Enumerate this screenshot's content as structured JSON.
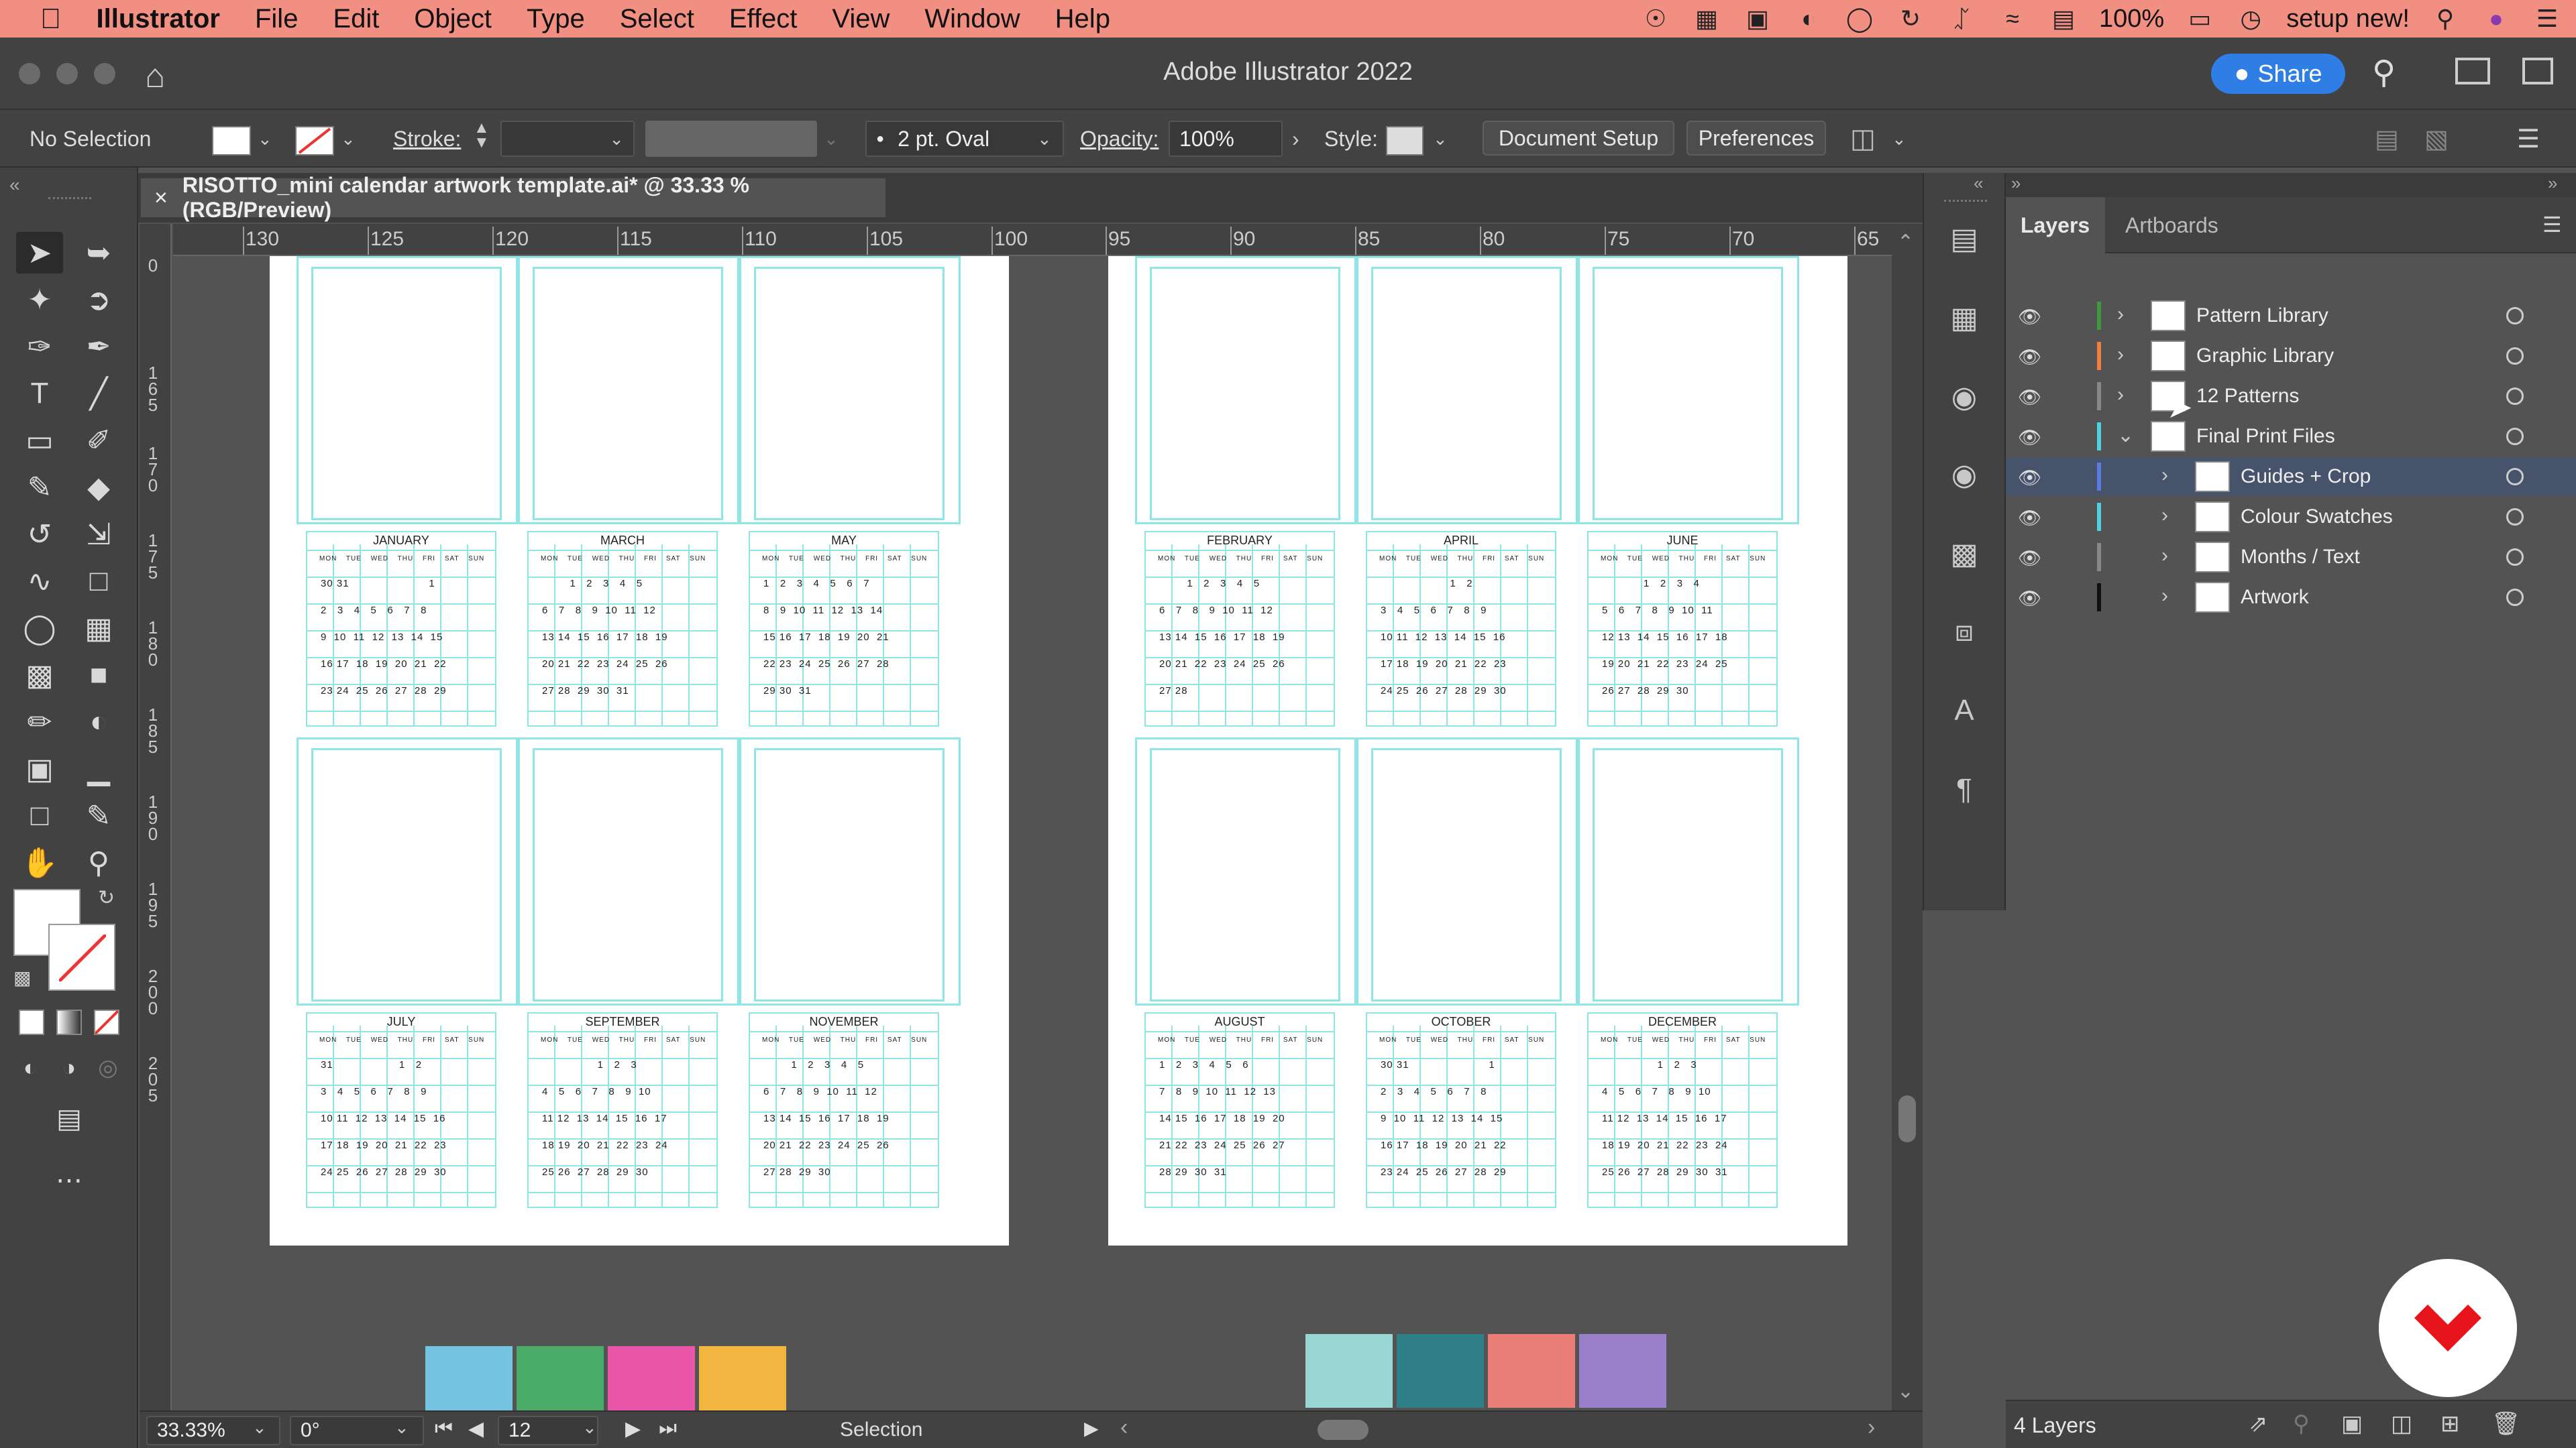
{
  "menubar": {
    "apple": "",
    "app": "Illustrator",
    "items": [
      "File",
      "Edit",
      "Object",
      "Type",
      "Select",
      "Effect",
      "View",
      "Window",
      "Help"
    ],
    "battery": "100%",
    "user": "setup new!"
  },
  "titlebar": {
    "title": "Adobe Illustrator 2022",
    "share_label": "Share"
  },
  "controlbar": {
    "selection": "No Selection",
    "stroke_label": "Stroke:",
    "brush": "2 pt. Oval",
    "opacity_label": "Opacity:",
    "opacity_value": "100%",
    "style_label": "Style:",
    "doc_setup": "Document Setup",
    "preferences": "Preferences"
  },
  "document": {
    "tab_title": "RISOTTO_mini calendar artwork template.ai* @ 33.33 % (RGB/Preview)"
  },
  "rulers": {
    "h": [
      "130",
      "125",
      "120",
      "115",
      "110",
      "105",
      "100",
      "95",
      "90",
      "85",
      "80",
      "75",
      "70",
      "65"
    ],
    "v": [
      "0",
      "165",
      "170",
      "175",
      "180",
      "185",
      "190",
      "195",
      "200",
      "205"
    ]
  },
  "calendar": {
    "left": {
      "top": [
        {
          "month": "JANUARY",
          "rows": [
            "30 31                       1",
            "2   3   4   5   6   7   8",
            "9  10  11  12  13  14  15",
            "16 17  18  19  20  21  22",
            "23 24  25  26  27  28  29"
          ]
        },
        {
          "month": "MARCH",
          "rows": [
            "        1   2   3   4   5",
            "6   7   8   9  10  11  12",
            "13 14  15  16  17  18  19",
            "20 21  22  23  24  25  26",
            "27 28  29  30  31"
          ]
        },
        {
          "month": "MAY",
          "rows": [
            "1   2   3   4   5   6   7",
            "8   9  10  11  12  13  14",
            "15 16  17  18  19  20  21",
            "22 23  24  25  26  27  28",
            "29 30  31"
          ]
        }
      ],
      "bottom": [
        {
          "month": "JULY",
          "rows": [
            "31                   1   2",
            "3   4   5   6   7   8   9",
            "10 11  12  13  14  15  16",
            "17 18  19  20  21  22  23",
            "24 25  26  27  28  29  30"
          ]
        },
        {
          "month": "SEPTEMBER",
          "rows": [
            "                1   2   3",
            "4   5   6   7   8   9  10",
            "11 12  13  14  15  16  17",
            "18 19  20  21  22  23  24",
            "25 26  27  28  29  30"
          ]
        },
        {
          "month": "NOVEMBER",
          "rows": [
            "        1   2   3   4   5",
            "6   7   8   9  10  11  12",
            "13 14  15  16  17  18  19",
            "20 21  22  23  24  25  26",
            "27 28  29  30"
          ]
        }
      ]
    },
    "right": {
      "top": [
        {
          "month": "FEBRUARY",
          "rows": [
            "        1   2   3   4   5",
            "6   7   8   9  10  11  12",
            "13 14  15  16  17  18  19",
            "20 21  22  23  24  25  26",
            "27 28"
          ]
        },
        {
          "month": "APRIL",
          "rows": [
            "                    1   2",
            "3   4   5   6   7   8   9",
            "10 11  12  13  14  15  16",
            "17 18  19  20  21  22  23",
            "24 25  26  27  28  29  30"
          ]
        },
        {
          "month": "JUNE",
          "rows": [
            "            1   2   3   4",
            "5   6   7   8   9  10  11",
            "12 13  14  15  16  17  18",
            "19 20  21  22  23  24  25",
            "26 27  28  29  30"
          ]
        }
      ],
      "bottom": [
        {
          "month": "AUGUST",
          "rows": [
            "1   2   3   4   5   6",
            "7   8   9  10  11  12  13",
            "14 15  16  17  18  19  20",
            "21 22  23  24  25  26  27",
            "28 29  30  31"
          ]
        },
        {
          "month": "OCTOBER",
          "rows": [
            "30 31                       1",
            "2   3   4   5   6   7   8",
            "9  10  11  12  13  14  15",
            "16 17  18  19  20  21  22",
            "23 24  25  26  27  28  29"
          ]
        },
        {
          "month": "DECEMBER",
          "rows": [
            "                1   2   3",
            "4   5   6   7   8   9  10",
            "11 12  13  14  15  16  17",
            "18 19  20  21  22  23  24",
            "25 26  27  28  29  30  31"
          ]
        }
      ]
    },
    "weekday_header": "MON TUE WED THU FRI SAT SUN"
  },
  "swatches_left": [
    "#74c3e1",
    "#4bab69",
    "#ea55a8",
    "#f2b540"
  ],
  "swatches_right": [
    "#9ad6d4",
    "#2f7f86",
    "#ec7e7a",
    "#9a7fcb"
  ],
  "statusbar": {
    "zoom": "33.33%",
    "rotation": "0°",
    "artboard": "12",
    "tool": "Selection"
  },
  "layers_panel": {
    "tab_layers": "Layers",
    "tab_artboards": "Artboards",
    "rows": [
      {
        "name": "Pattern Library",
        "color": "#3f9a3f",
        "indent": 0
      },
      {
        "name": "Graphic Library",
        "color": "#f08040",
        "indent": 0
      },
      {
        "name": "12 Patterns",
        "color": "#888888",
        "indent": 0
      },
      {
        "name": "Final Print Files",
        "color": "#4fd1e0",
        "indent": 0
      },
      {
        "name": "Guides + Crop",
        "color": "#5a7be0",
        "indent": 1
      },
      {
        "name": "Colour Swatches",
        "color": "#4fd1e0",
        "indent": 1
      },
      {
        "name": "Months / Text",
        "color": "#888888",
        "indent": 1
      },
      {
        "name": "Artwork",
        "color": "#111111",
        "indent": 1
      }
    ],
    "footer": "4 Layers"
  }
}
